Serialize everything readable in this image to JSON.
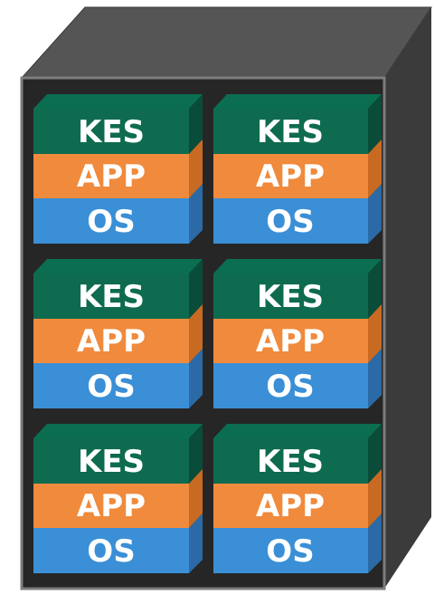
{
  "diagram": {
    "stacks": [
      {
        "top": "KES",
        "middle": "APP",
        "bottom": "OS"
      },
      {
        "top": "KES",
        "middle": "APP",
        "bottom": "OS"
      },
      {
        "top": "KES",
        "middle": "APP",
        "bottom": "OS"
      },
      {
        "top": "KES",
        "middle": "APP",
        "bottom": "OS"
      },
      {
        "top": "KES",
        "middle": "APP",
        "bottom": "OS"
      },
      {
        "top": "KES",
        "middle": "APP",
        "bottom": "OS"
      }
    ],
    "colors": {
      "kes": "#0e6b4f",
      "app": "#f08a3c",
      "os": "#3a8fd6",
      "server_front": "#262626",
      "server_top": "#5a5a5a",
      "server_side": "#3b3b3b"
    }
  }
}
